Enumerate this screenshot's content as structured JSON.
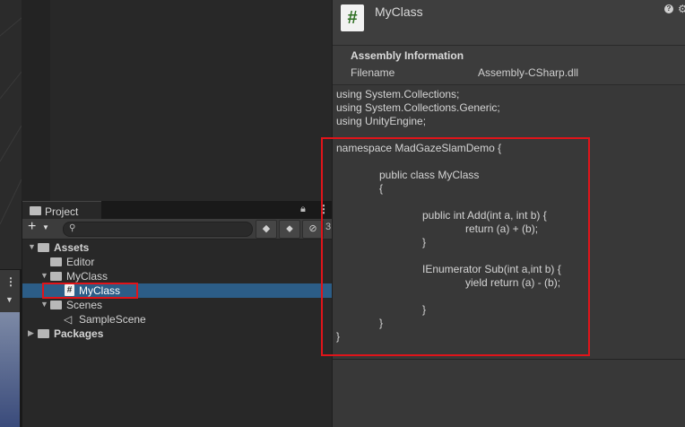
{
  "project_panel": {
    "tab_label": "Project",
    "search_placeholder": "",
    "count_badge": "3",
    "tree": [
      {
        "label": "Assets",
        "bold": true
      },
      {
        "label": "Editor"
      },
      {
        "label": "MyClass"
      },
      {
        "label": "MyClass",
        "selected": true
      },
      {
        "label": "Scenes"
      },
      {
        "label": "SampleScene"
      },
      {
        "label": "Packages",
        "bold": true
      }
    ]
  },
  "inspector": {
    "title": "MyClass",
    "file_icon_glyph": "#",
    "assembly": {
      "heading": "Assembly Information",
      "filename_label": "Filename",
      "filename_value": "Assembly-CSharp.dll"
    },
    "code_lines": [
      "using System.Collections;",
      "using System.Collections.Generic;",
      "using UnityEngine;",
      "namespace MadGazeSlamDemo {",
      "public class MyClass",
      "{",
      "public int Add(int a, int b) {",
      "return (a) + (b);",
      "}",
      "IEnumerator Sub(int a,int b) {",
      "yield return (a) - (b);",
      "}",
      "}",
      "}"
    ]
  },
  "colors": {
    "selection": "#2c5d87",
    "highlight_box": "#e0141a",
    "csharp_icon": "#2e6e22"
  }
}
